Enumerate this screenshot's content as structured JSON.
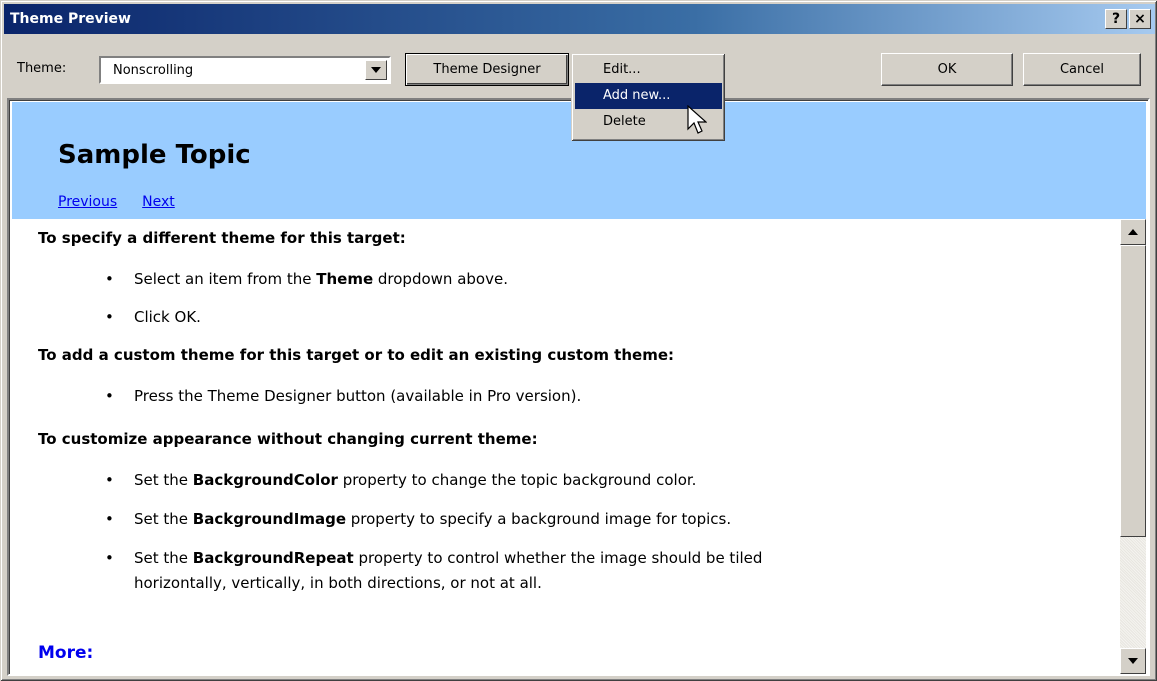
{
  "window": {
    "title": "Theme Preview",
    "help_glyph": "?",
    "close_glyph": "×"
  },
  "toolbar": {
    "theme_label": "Theme:",
    "theme_value": "Nonscrolling",
    "theme_designer_label": "Theme Designer",
    "ok_label": "OK",
    "cancel_label": "Cancel"
  },
  "menu": {
    "items": [
      {
        "label": "Edit..."
      },
      {
        "label": "Add new...",
        "selected": true
      },
      {
        "label": "Delete"
      }
    ]
  },
  "topic": {
    "title": "Sample Topic",
    "nav_previous": "Previous",
    "nav_next": "Next",
    "heading1": "To specify a different theme for this target:",
    "h1_item1_pre": "Select an item from the ",
    "h1_item1_bold": "Theme",
    "h1_item1_post": " dropdown above.",
    "h1_item2": "Click OK.",
    "heading2": "To add a custom theme for this target or to edit an existing custom theme:",
    "h2_item1": "Press the Theme Designer button (available in Pro version).",
    "heading3": "To customize appearance without changing current theme:",
    "h3_item1_pre": "Set the ",
    "h3_item1_bold": "BackgroundColor",
    "h3_item1_post": " property to change the topic background color.",
    "h3_item2_pre": "Set the ",
    "h3_item2_bold": "BackgroundImage",
    "h3_item2_post": " property to specify a background image for topics.",
    "h3_item3_pre": "Set the ",
    "h3_item3_bold": "BackgroundRepeat",
    "h3_item3_post": " property to control whether the image should be tiled",
    "h3_item3_line2": "horizontally, vertically, in both directions, or not at all.",
    "more": "More:"
  },
  "colors": {
    "header_bg": "#99ccff",
    "titlebar": "#0a246a",
    "menu_highlight": "#0a246a",
    "link": "#0000ee"
  },
  "icons": {
    "combo_arrow": "triangle-down-icon",
    "scroll_up": "triangle-up-icon",
    "scroll_down": "triangle-down-icon",
    "cursor": "arrow-pointer-icon"
  }
}
